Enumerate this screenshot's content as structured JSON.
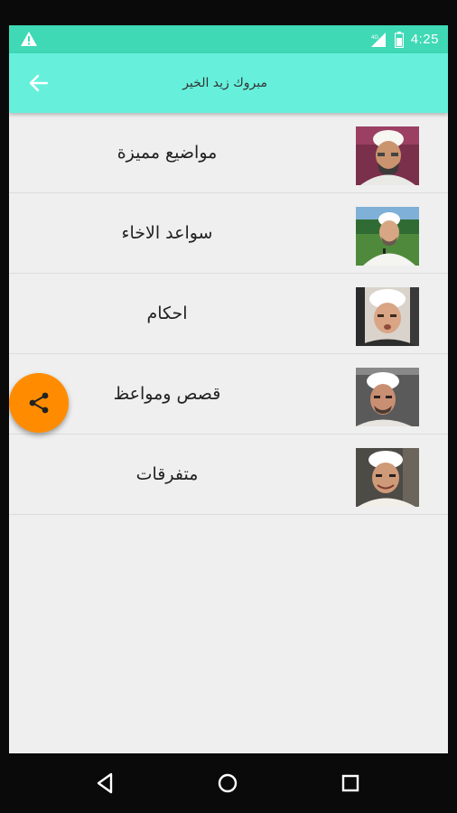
{
  "status_bar": {
    "time": "4:25",
    "network": "4G",
    "icons": [
      "warning-icon",
      "signal-icon",
      "battery-icon"
    ]
  },
  "app_bar": {
    "title": "مبروك زيد الخير",
    "back_icon": "arrow-left-icon"
  },
  "list": {
    "items": [
      {
        "label": "مواضيع مميزة",
        "image": "sheikh-portrait-1"
      },
      {
        "label": "سواعد الاخاء",
        "image": "sheikh-portrait-2"
      },
      {
        "label": "احكام",
        "image": "sheikh-portrait-3"
      },
      {
        "label": "قصص ومواعظ",
        "image": "sheikh-portrait-4"
      },
      {
        "label": "متفرقات",
        "image": "sheikh-portrait-5"
      }
    ]
  },
  "fab": {
    "icon": "share-icon"
  },
  "nav_bar": {
    "icons": [
      "back-triangle-icon",
      "home-circle-icon",
      "recents-square-icon"
    ]
  },
  "colors": {
    "status_bar": "#3fd9b6",
    "app_bar": "#66f0dc",
    "fab": "#ff8c00",
    "background": "#efefef"
  }
}
